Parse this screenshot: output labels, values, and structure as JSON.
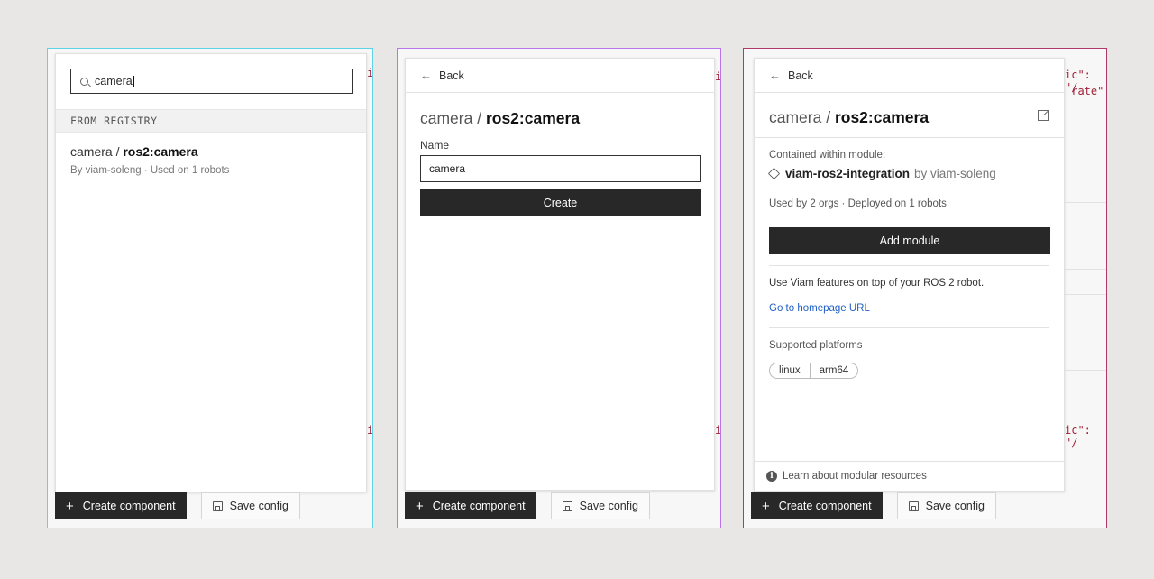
{
  "bottom_bar": {
    "create_label": "Create component",
    "save_label": "Save config"
  },
  "search_panel": {
    "query": "camera",
    "section_header": "FROM REGISTRY",
    "result": {
      "prefix": "camera / ",
      "name": "ros2:camera",
      "subtitle": "By viam-soleng · Used on 1 robots"
    }
  },
  "create_panel": {
    "back_label": "Back",
    "title_prefix": "camera / ",
    "title_name": "ros2:camera",
    "name_label": "Name",
    "name_value": "camera",
    "create_label": "Create"
  },
  "detail_panel": {
    "back_label": "Back",
    "title_prefix": "camera / ",
    "title_name": "ros2:camera",
    "contained_label": "Contained within module:",
    "module_name": "viam-ros2-integration",
    "module_by": "by viam-soleng",
    "usage": "Used by 2 orgs · Deployed on 1 robots",
    "add_label": "Add module",
    "description": "Use Viam features on top of your ROS 2 robot.",
    "homepage_link": "Go to homepage URL",
    "platforms_label": "Supported platforms",
    "platforms": [
      "linux",
      "arm64"
    ],
    "footer_text": "Learn about modular resources"
  },
  "background": {
    "frag_1": "i",
    "frag_2": "ic\": \"/",
    "frag_3": "_rate\""
  }
}
